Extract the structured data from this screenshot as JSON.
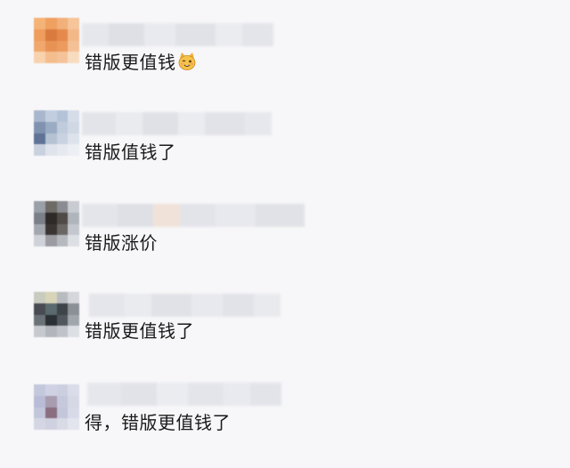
{
  "comments": [
    {
      "text": "错版更值钱",
      "emoji": "cat-face-emoji"
    },
    {
      "text": "错版值钱了"
    },
    {
      "text": "错版涨价"
    },
    {
      "text": "错版更值钱了"
    },
    {
      "text": "得，错版更值钱了"
    }
  ],
  "colors": {
    "background": "#f7f7f9",
    "text": "#1a1a1a"
  }
}
